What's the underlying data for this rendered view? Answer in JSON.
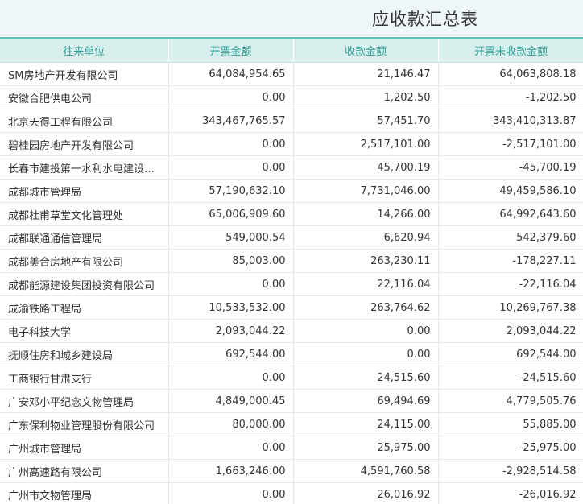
{
  "title": "应收款汇总表",
  "columns": [
    "往来单位",
    "开票金额",
    "收款金额",
    "开票未收款金额"
  ],
  "rows": [
    [
      "SM房地产开发有限公司",
      "64,084,954.65",
      "21,146.47",
      "64,063,808.18"
    ],
    [
      "安徽合肥供电公司",
      "0.00",
      "1,202.50",
      "-1,202.50"
    ],
    [
      "北京天得工程有限公司",
      "343,467,765.57",
      "57,451.70",
      "343,410,313.87"
    ],
    [
      "碧桂园房地产开发有限公司",
      "0.00",
      "2,517,101.00",
      "-2,517,101.00"
    ],
    [
      "长春市建投第一水利水电建设…",
      "0.00",
      "45,700.19",
      "-45,700.19"
    ],
    [
      "成都城市管理局",
      "57,190,632.10",
      "7,731,046.00",
      "49,459,586.10"
    ],
    [
      "成都杜甫草堂文化管理处",
      "65,006,909.60",
      "14,266.00",
      "64,992,643.60"
    ],
    [
      "成都联通通信管理局",
      "549,000.54",
      "6,620.94",
      "542,379.60"
    ],
    [
      "成都美合房地产有限公司",
      "85,003.00",
      "263,230.11",
      "-178,227.11"
    ],
    [
      "成都能源建设集团投资有限公司",
      "0.00",
      "22,116.04",
      "-22,116.04"
    ],
    [
      "成渝铁路工程局",
      "10,533,532.00",
      "263,764.62",
      "10,269,767.38"
    ],
    [
      "电子科技大学",
      "2,093,044.22",
      "0.00",
      "2,093,044.22"
    ],
    [
      "抚顺住房和城乡建设局",
      "692,544.00",
      "0.00",
      "692,544.00"
    ],
    [
      "工商银行甘肃支行",
      "0.00",
      "24,515.60",
      "-24,515.60"
    ],
    [
      "广安邓小平纪念文物管理局",
      "4,849,000.45",
      "69,494.69",
      "4,779,505.76"
    ],
    [
      "广东保利物业管理股份有限公司",
      "80,000.00",
      "24,115.00",
      "55,885.00"
    ],
    [
      "广州城市管理局",
      "0.00",
      "25,975.00",
      "-25,975.00"
    ],
    [
      "广州高速路有限公司",
      "1,663,246.00",
      "4,591,760.58",
      "-2,928,514.58"
    ],
    [
      "广州市文物管理局",
      "0.00",
      "26,016.92",
      "-26,016.92"
    ]
  ]
}
